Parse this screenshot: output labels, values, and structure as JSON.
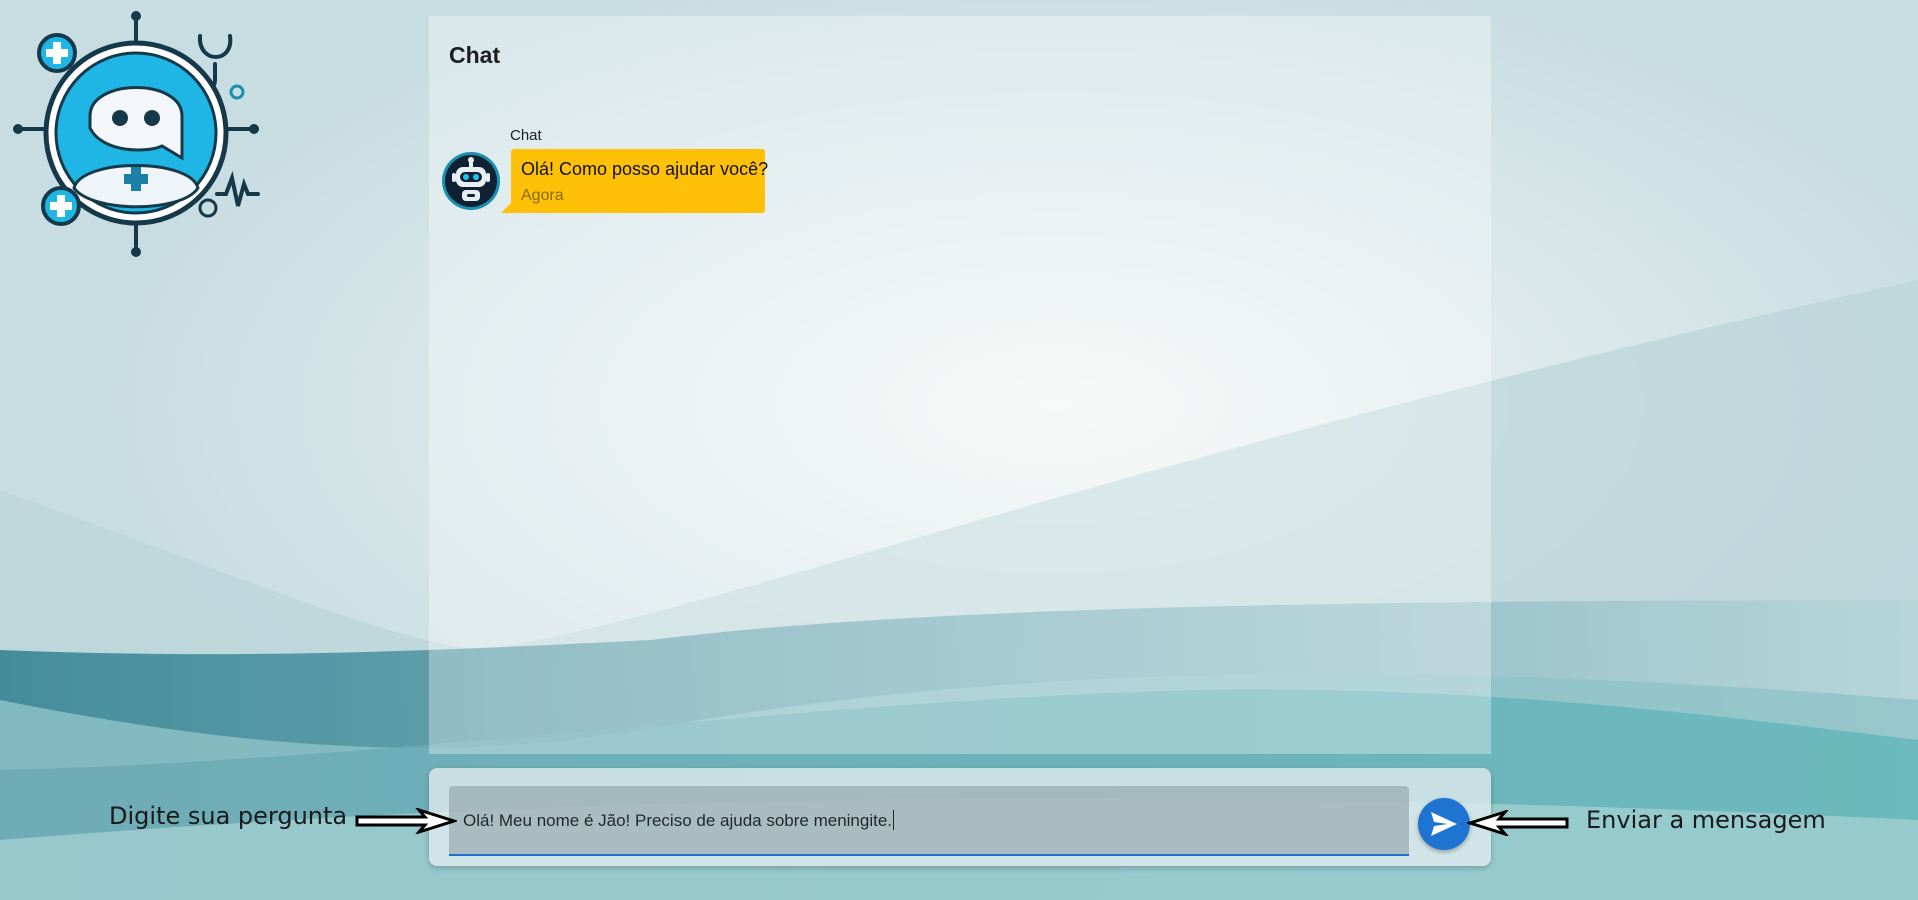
{
  "chat": {
    "title": "Chat",
    "messages": [
      {
        "sender": "Chat",
        "text": "Olá! Como posso ajudar você?",
        "time": "Agora"
      }
    ]
  },
  "input": {
    "value": "Olá! Meu nome é Jão! Preciso de ajuda sobre meningite."
  },
  "annotations": {
    "left": "Digite sua pergunta",
    "right": "Enviar a mensagem"
  },
  "icons": {
    "logo": "medical-chatbot-logo",
    "avatar": "robot-icon",
    "send": "send-icon"
  },
  "colors": {
    "bubble": "#ffc107",
    "accent": "#1f74d2"
  }
}
